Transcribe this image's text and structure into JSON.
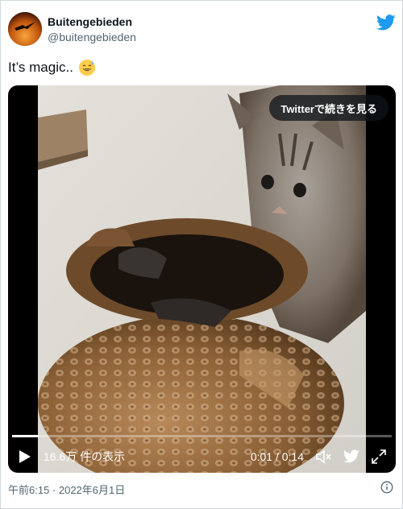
{
  "author": {
    "display_name": "Buitengebieden",
    "handle": "@buitengebieden"
  },
  "tweet": {
    "text": "It’s magic..",
    "emoji": "grinning-face-with-sweat-emoji"
  },
  "media": {
    "cta_label": "Twitterで続きを見る",
    "view_count": "16.6万 件の表示",
    "timecode": "0:01 / 0:14",
    "progress_fraction": 0.07
  },
  "footer": {
    "timestamp": "午前6:15 · 2022年6月1日"
  },
  "icons": {
    "twitter_logo": "twitter-bird-icon",
    "play": "play-icon",
    "volume": "volume-icon",
    "fullscreen": "fullscreen-icon",
    "info": "info-icon"
  },
  "colors": {
    "brand": "#1d9bf0",
    "text_primary": "#0f1419",
    "text_secondary": "#536471",
    "border": "#cfd9de"
  }
}
